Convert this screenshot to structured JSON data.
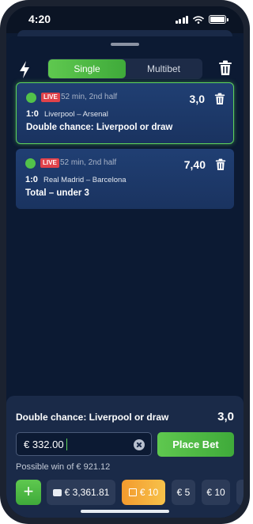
{
  "status_bar": {
    "time": "4:20"
  },
  "toolbar": {
    "tabs": [
      {
        "label": "Single",
        "active": true
      },
      {
        "label": "Multibet",
        "active": false
      }
    ]
  },
  "bets": [
    {
      "status": "LIVE",
      "time": "52 min, 2nd half",
      "score": "1:0",
      "teams": "Liverpool – Arsenal",
      "market": "Double chance: Liverpool or draw",
      "odds": "3,0",
      "selected": true
    },
    {
      "status": "LIVE",
      "time": "52 min, 2nd half",
      "score": "1:0",
      "teams": "Real Madrid – Barcelona",
      "market": "Total – under 3",
      "odds": "7,40",
      "selected": false
    }
  ],
  "betslip": {
    "selection": "Double chance: Liverpool or draw",
    "odds": "3,0",
    "stake_value": "€ 332.00",
    "place_bet_label": "Place Bet",
    "possible_win": "Possible win of € 921.12"
  },
  "quick_chips": {
    "add_label": "+",
    "balance": "€ 3,361.81",
    "bonus": "€ 10",
    "amounts": [
      "€ 5",
      "€ 10"
    ]
  },
  "colors": {
    "accent_green": "#52c24a",
    "live_red": "#e0424a",
    "bonus_orange": "#f39a2e",
    "background": "#0c1a33"
  }
}
